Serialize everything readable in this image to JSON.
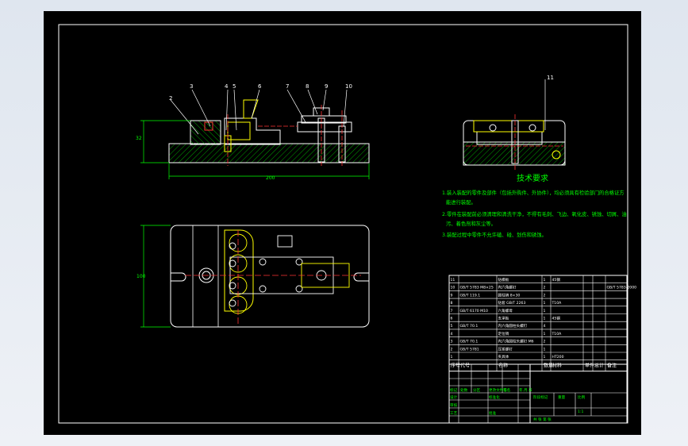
{
  "drawing": {
    "balloons": [
      "2",
      "3",
      "4",
      "5",
      "6",
      "7",
      "8",
      "9",
      "10"
    ],
    "balloon_right": "11",
    "dim_height": "32",
    "dim_base_width": "200",
    "dim_plan_height": "100"
  },
  "tech_requirements": {
    "title": "技术要求",
    "lines": [
      "1.装入装配的零件及部件（包括外购件、外协件），均必须具有检验部门的合格证方",
      "能进行装配。",
      "2.零件在装配前必须清理和清洗干净，不得有毛刺、飞边、氧化皮、锈蚀、切屑、油",
      "污、着色剂和灰尘等。",
      "3.装配过程中零件不允许磕、碰、划伤和锈蚀。"
    ]
  },
  "bom": {
    "rows": [
      {
        "no": "11",
        "code": "",
        "name": "钻模板",
        "qty": "1",
        "material": "45钢",
        "note": ""
      },
      {
        "no": "10",
        "code": "GB/T 5783 M8×25",
        "name": "内六角螺钉",
        "qty": "2",
        "material": "",
        "note": "GB/T 5783-2000"
      },
      {
        "no": "9",
        "code": "GB/T 119.1",
        "name": "圆柱销 8×30",
        "qty": "2",
        "material": "",
        "note": ""
      },
      {
        "no": "8",
        "code": "",
        "name": "钻套 GB/T 2263",
        "qty": "1",
        "material": "T10A",
        "note": ""
      },
      {
        "no": "7",
        "code": "GB/T 6170 M10",
        "name": "六角螺母",
        "qty": "1",
        "material": "",
        "note": ""
      },
      {
        "no": "6",
        "code": "",
        "name": "支承板",
        "qty": "1",
        "material": "45钢",
        "note": ""
      },
      {
        "no": "5",
        "code": "GB/T 70.1",
        "name": "内六角圆柱头螺钉",
        "qty": "4",
        "material": "",
        "note": ""
      },
      {
        "no": "4",
        "code": "",
        "name": "定位销",
        "qty": "1",
        "material": "T10A",
        "note": ""
      },
      {
        "no": "3",
        "code": "GB/T 70.1",
        "name": "内六角圆柱头螺钉 M6",
        "qty": "2",
        "material": "",
        "note": ""
      },
      {
        "no": "2",
        "code": "GB/T 5781",
        "name": "压紧螺钉",
        "qty": "1",
        "material": "",
        "note": ""
      },
      {
        "no": "1",
        "code": "",
        "name": "夹具体",
        "qty": "1",
        "material": "HT200",
        "note": ""
      }
    ],
    "header": {
      "no": "序号",
      "code": "代号",
      "name": "名称",
      "qty": "数量",
      "material": "材料",
      "unit_w": "单件",
      "total_w": "总计",
      "weight": "重量",
      "note": "备注"
    }
  },
  "title_block": {
    "stage": "阶段标记",
    "weight": "重量",
    "scale": "比例",
    "scale_val": "1:1",
    "sheets": "共  张  第  张",
    "row_labels": [
      "标记",
      "处数",
      "分区",
      "更改文件号",
      "签名",
      "年.月.日"
    ],
    "design": "设计",
    "standard": "标准化",
    "review": "审核",
    "craft": "工艺",
    "approve": "批准"
  },
  "colors": {
    "outer": "#ffffff",
    "part": "#ffffff",
    "hatch": "#00ff00",
    "center": "#ff3333",
    "accent": "#ffff00",
    "dim": "#00ff00",
    "text": "#00ff00"
  }
}
